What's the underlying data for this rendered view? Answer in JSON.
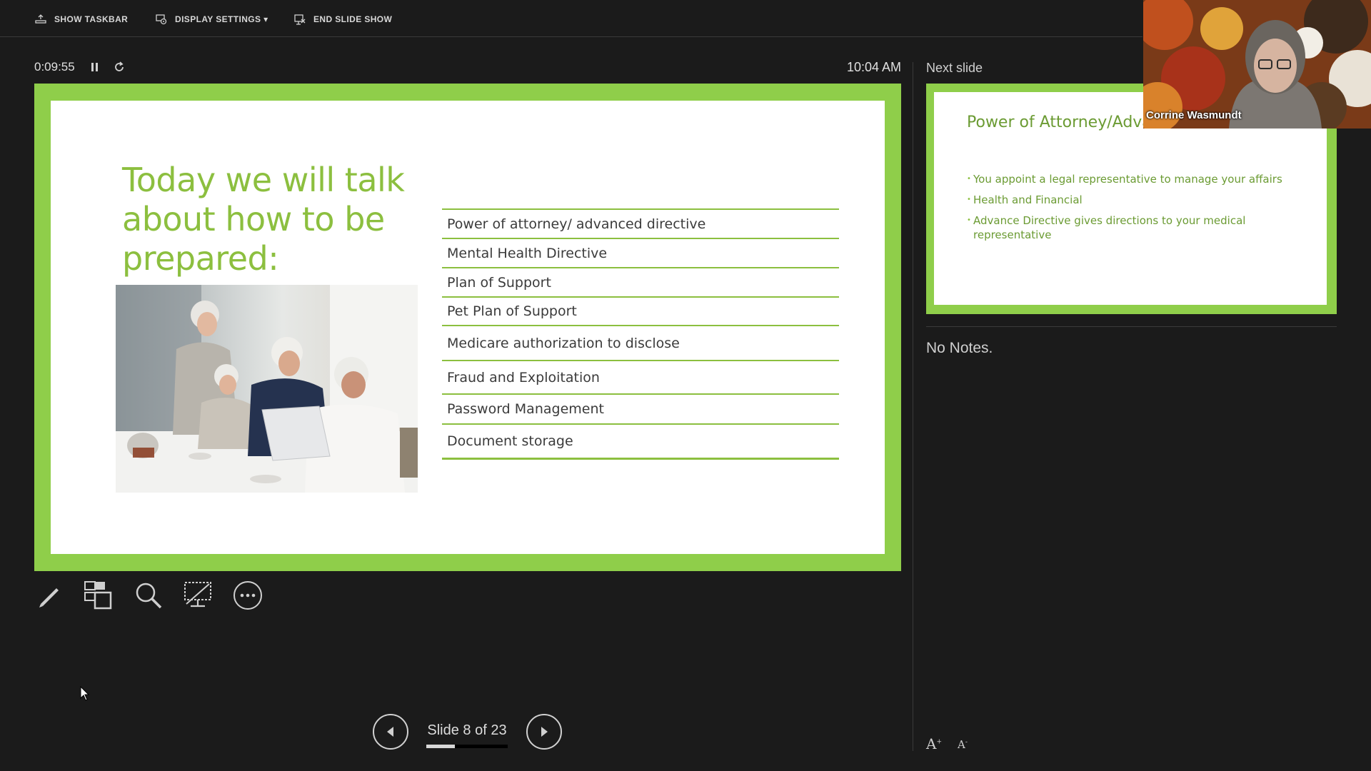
{
  "toolbar": {
    "show_taskbar": "SHOW TASKBAR",
    "display_settings": "DISPLAY SETTINGS ▾",
    "end_slide_show": "END SLIDE SHOW"
  },
  "timer": {
    "elapsed": "0:09:55",
    "clock": "10:04 AM"
  },
  "current_slide": {
    "title": "Today we will talk about how to be prepared:",
    "items": [
      "Power of attorney/ advanced directive",
      "Mental Health Directive",
      "Plan of Support",
      "Pet Plan of Support",
      "Medicare authorization to disclose",
      "Fraud and Exploitation",
      " Password Management",
      "Document storage"
    ],
    "accent_color": "#8cbf3f",
    "frame_color": "#8fce4a"
  },
  "tools": [
    "pen-tool-icon",
    "see-all-slides-icon",
    "zoom-icon",
    "black-screen-icon",
    "more-options-icon"
  ],
  "navigation": {
    "counter": "Slide 8 of 23",
    "current": 8,
    "total": 23
  },
  "next_slide": {
    "label": "Next slide",
    "title": "Power of Attorney/Advance Directives",
    "bullets": [
      "You appoint a legal representative to manage your affairs",
      "Health and Financial",
      "Advance Directive gives directions to your medical representative"
    ]
  },
  "notes": {
    "text": "No Notes."
  },
  "webcam": {
    "name": "Corrine Wasmundt"
  },
  "font_controls": {
    "increase": "A",
    "decrease": "A"
  }
}
